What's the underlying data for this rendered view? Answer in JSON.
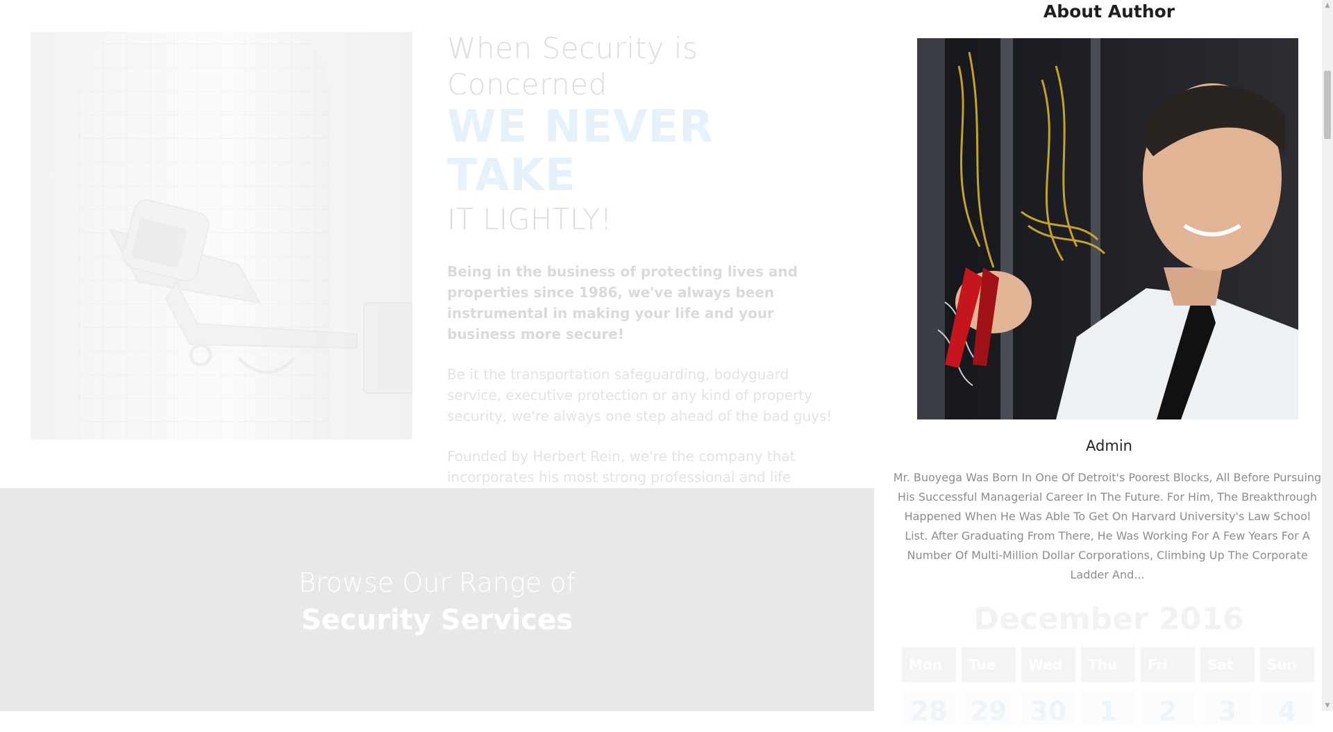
{
  "hero": {
    "heading_line1": "When Security is Concerned",
    "heading_line2": "WE NEVER TAKE",
    "heading_line3": "IT LIGHTLY!",
    "lead": "Being in the business of protecting lives and properties since 1986, we've always been instrumental in making your life and your business more secure!",
    "paragraph1": "Be it the transportation safeguarding, bodyguard service, executive protection or any kind of property security, we're always one step ahead of the bad guys!",
    "paragraph2": "Founded by Herbert Rein, we're the company that incorporates his most strong professional and life convictions.",
    "image_icon": "security-camera-image"
  },
  "services": {
    "title_line1": "Browse Our Range of",
    "title_line2": "Security Services",
    "background_color": "#e8e8ea"
  },
  "sidebar": {
    "widget_title": "About Author",
    "author_photo": "author-portrait-image",
    "author_name": "Admin",
    "author_bio": "Mr. Buoyega Was Born In One Of Detroit's Poorest Blocks, All Before Pursuing His Successful Managerial Career In The Future. For Him, The Breakthrough Happened When He Was Able To Get On Harvard University's Law School List. After Graduating From There, He Was Working For A Few Years For A Number Of Multi-Million Dollar Corporations, Climbing Up The Corporate Ladder And..."
  },
  "calendar": {
    "title": "December 2016",
    "weekdays": [
      "Mon",
      "Tue",
      "Wed",
      "Thu",
      "Fri",
      "Sat",
      "Sun"
    ],
    "first_week": [
      "28",
      "29",
      "30",
      "1",
      "2",
      "3",
      "4"
    ]
  },
  "scrollbar": {
    "up_icon": "arrow-up-icon",
    "down_icon": "arrow-down-icon"
  },
  "colors": {
    "accent_light_blue": "#e6f2fb",
    "muted_text": "#dcdcdc",
    "bio_text": "#8c8c8c",
    "heading_dark": "#1f1f1f"
  }
}
